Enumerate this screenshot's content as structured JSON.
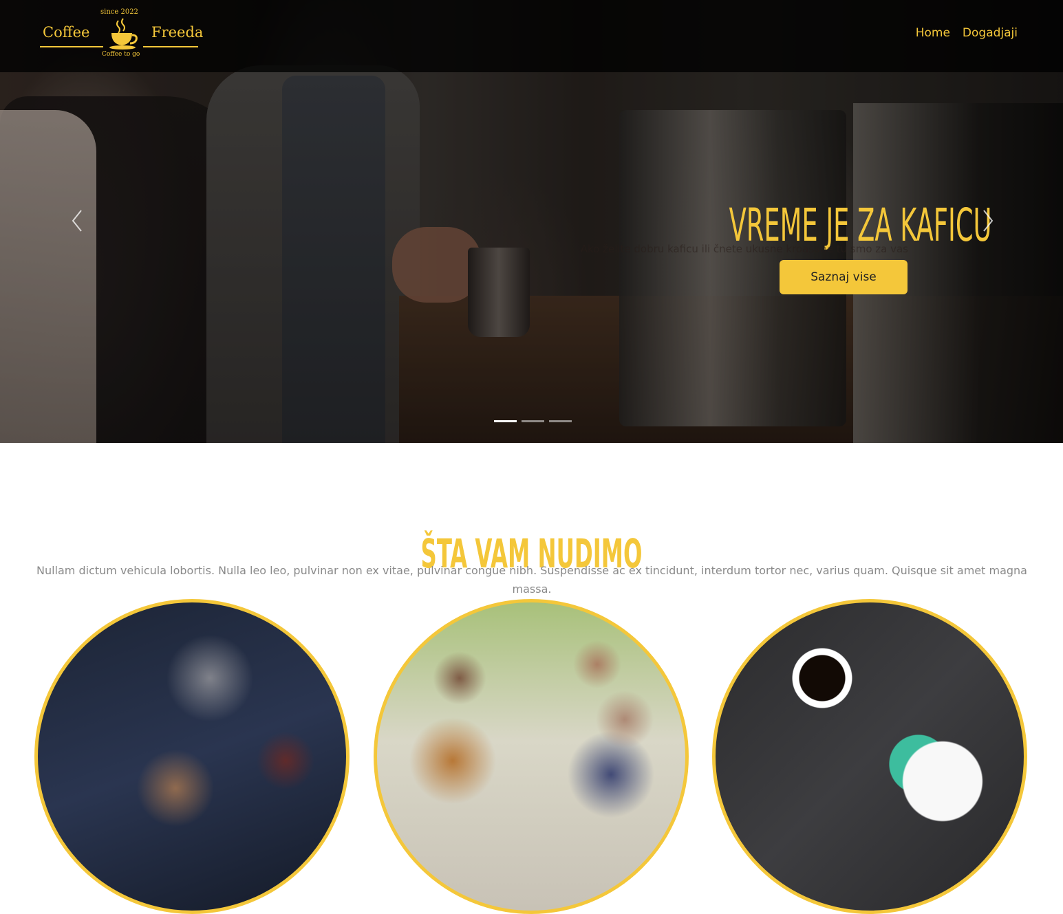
{
  "brand": {
    "name_left": "Coffee",
    "name_right": "Freeda",
    "since": "since 2022",
    "tagline": "Coffee to go",
    "accent_color": "#f4c73a"
  },
  "nav": {
    "items": [
      {
        "label": "Home"
      },
      {
        "label": "Dogadjaji"
      }
    ]
  },
  "hero": {
    "title": "VREME JE ZA KAFICU",
    "subtitle": "Ako želite dobru kaficu ili čnete ukusne kroasane tu smo za vas",
    "button_label": "Saznaj vise",
    "prev_icon": "chevron-left-icon",
    "next_icon": "chevron-right-icon",
    "slide_count": 3,
    "active_slide": 1
  },
  "offer": {
    "title": "ŠTA VAM NUDIMO",
    "text": "Nullam dictum vehicula lobortis. Nulla leo leo, pulvinar non ex vitae, pulvinar congue nibh. Suspendisse ac ex tincidunt, interdum tortor nec, varius quam. Quisque sit amet magna massa."
  }
}
